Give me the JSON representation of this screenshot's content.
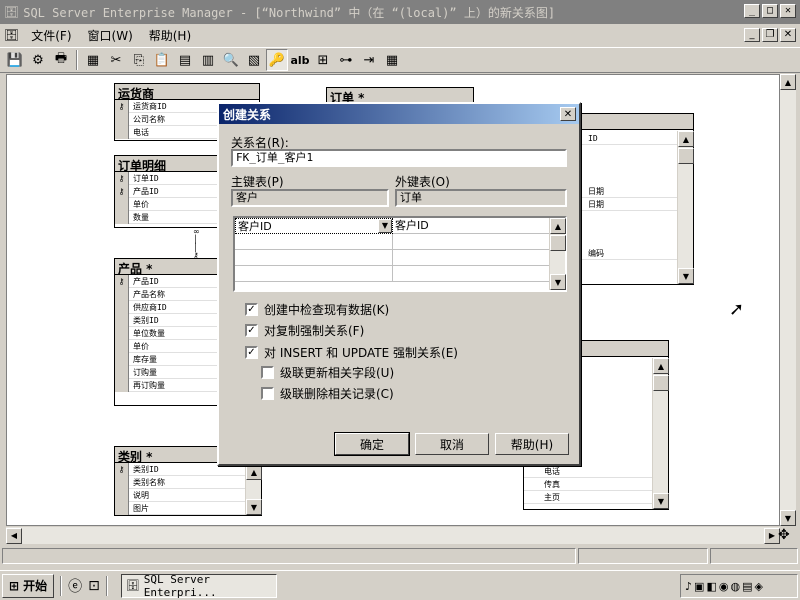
{
  "window": {
    "title": "SQL Server Enterprise Manager - [“Northwind” 中（在 “(local)” 上）的新关系图]"
  },
  "menu": {
    "file": "文件(F)",
    "window": "窗口(W)",
    "help": "帮助(H)"
  },
  "tables": {
    "shippers": {
      "title": "运货商",
      "rows": [
        "运货商ID",
        "公司名称",
        "电话"
      ]
    },
    "order_details": {
      "title": "订单明细",
      "rows": [
        "订单ID",
        "产品ID",
        "单价",
        "数量"
      ]
    },
    "products": {
      "title": "产品 *",
      "rows": [
        "产品ID",
        "产品名称",
        "供应商ID",
        "类别ID",
        "单位数量",
        "单价",
        "库存量",
        "订购量",
        "再订购量"
      ]
    },
    "categories": {
      "title": "类别 *",
      "rows": [
        "类别ID",
        "类别名称",
        "说明",
        "图片"
      ]
    },
    "orders": {
      "title": "订单 *"
    },
    "right_a": {
      "rows": [
        "ID",
        "日期",
        "日期",
        "编码"
      ]
    },
    "right_b": {
      "rows": [
        "电话",
        "传真",
        "主页"
      ]
    }
  },
  "dialog": {
    "title": "创建关系",
    "name_label": "关系名(R):",
    "name_value": "FK_订单_客户1",
    "pk_label": "主键表(P)",
    "fk_label": "外键表(O)",
    "pk_table": "客户",
    "fk_table": "订单",
    "pk_column": "客户ID",
    "fk_column": "客户ID",
    "check_existing": "创建中检查现有数据(K)",
    "enforce_replication": "对复制强制关系(F)",
    "enforce_ins_upd": "对 INSERT 和 UPDATE 强制关系(E)",
    "cascade_update": "级联更新相关字段(U)",
    "cascade_delete": "级联删除相关记录(C)",
    "ok": "确定",
    "cancel": "取消",
    "help": "帮助(H)"
  },
  "taskbar": {
    "start": "开始",
    "task": "SQL Server Enterpri..."
  }
}
